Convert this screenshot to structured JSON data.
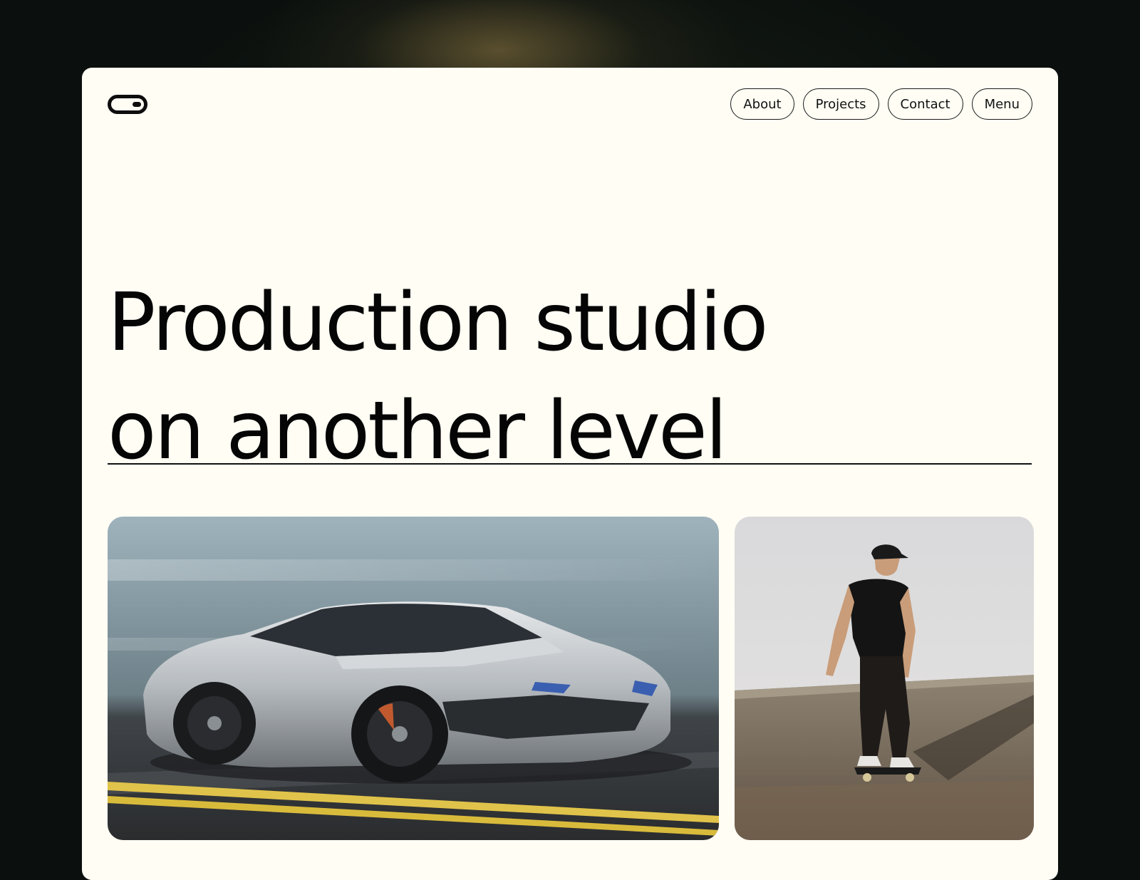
{
  "brand": {
    "logo_icon": "pill-toggle-logo-icon"
  },
  "nav": {
    "items": [
      {
        "label": "About"
      },
      {
        "label": "Projects"
      },
      {
        "label": "Contact"
      },
      {
        "label": "Menu"
      }
    ]
  },
  "hero": {
    "headline_line_1": "Production studio",
    "headline_line_2": "on another level"
  },
  "colors": {
    "page_background": "#121a14",
    "card_background": "#fffdf4",
    "text": "#050505"
  },
  "gallery": {
    "images": [
      {
        "subject": "silver sports car on road"
      },
      {
        "subject": "skateboarder on concrete"
      }
    ]
  }
}
